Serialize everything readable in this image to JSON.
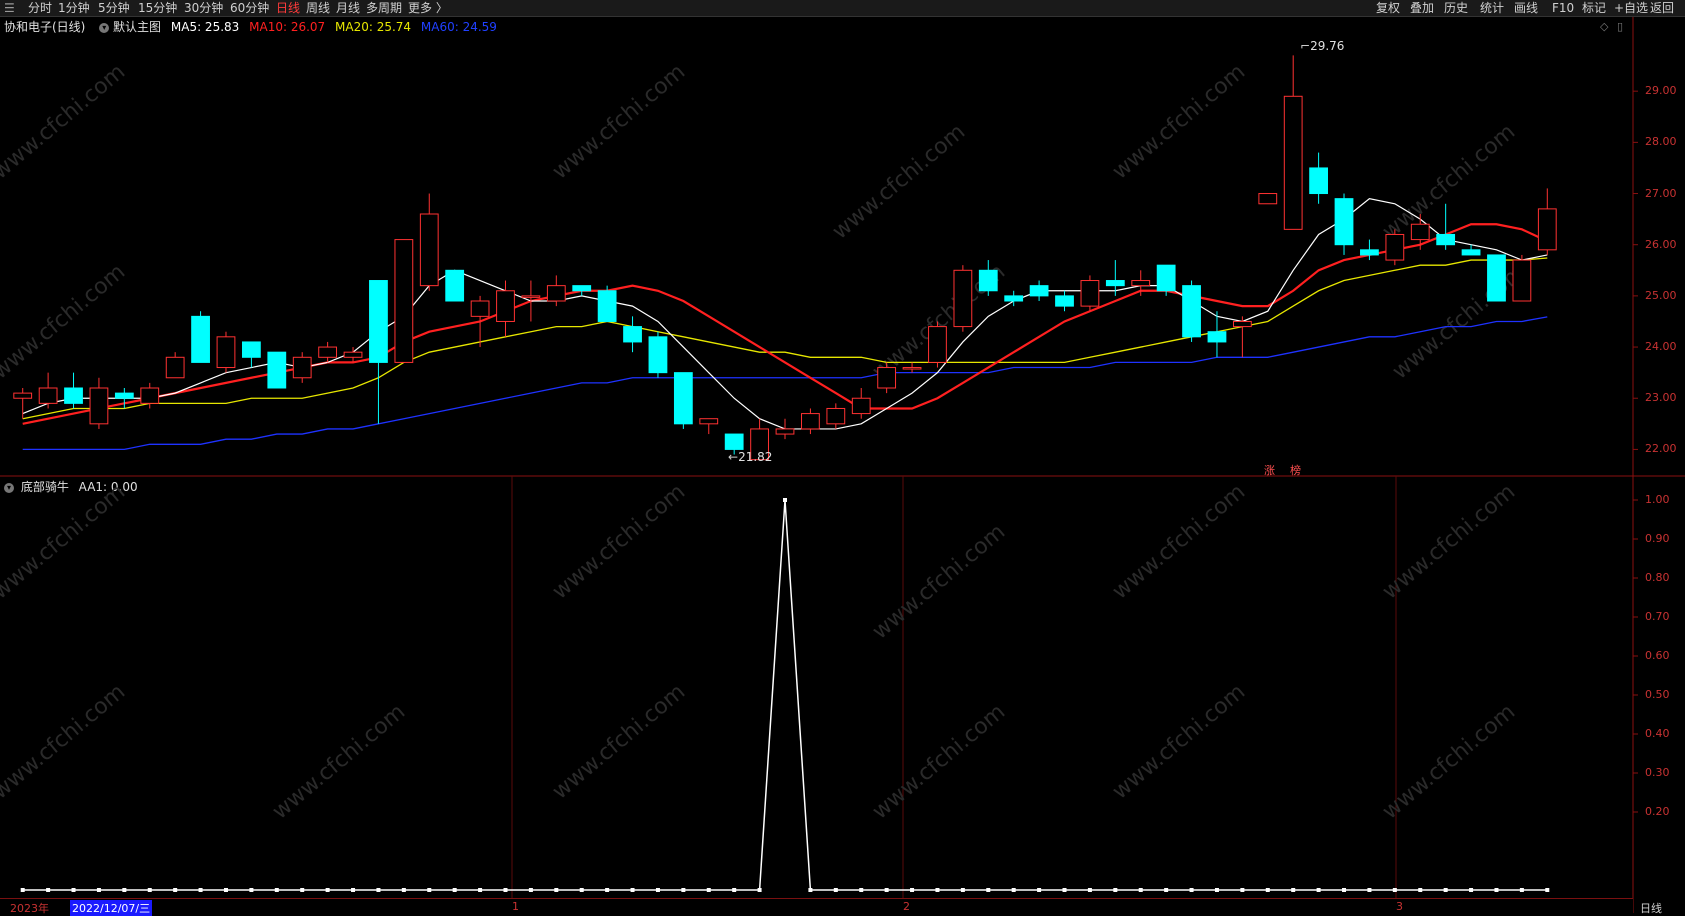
{
  "toolbar": {
    "menu_icon": "menu-icon",
    "periods": [
      "分时",
      "1分钟",
      "5分钟",
      "15分钟",
      "30分钟",
      "60分钟",
      "日线",
      "周线",
      "月线",
      "多周期",
      "更多 〉"
    ],
    "active_period": "日线",
    "right_items": [
      "复权",
      "叠加",
      "历史",
      "统计",
      "画线",
      "F10",
      "标记",
      "+自选",
      "返回"
    ]
  },
  "main_chart": {
    "stock_title": "协和电子(日线)",
    "template": "默认主图",
    "ma5": "MA5: 25.83",
    "ma10": "MA10: 26.07",
    "ma20": "MA20: 25.74",
    "ma60": "MA60: 24.59",
    "high_annotation": "29.76",
    "low_annotation": "21.82",
    "badges": [
      "涨",
      "榜"
    ],
    "price_ticks": [
      "29.00",
      "28.00",
      "27.00",
      "26.00",
      "25.00",
      "24.00",
      "23.00",
      "22.00"
    ],
    "colors": {
      "up": "#ff3232",
      "down": "#00ffff",
      "ma5": "#ffffff",
      "ma10": "#ff2020",
      "ma20": "#e6e600",
      "ma60": "#1e32ff"
    }
  },
  "sub_chart": {
    "indicator_name": "底部骑牛",
    "aa1": "AA1: 0.00",
    "ticks": [
      "1.00",
      "0.90",
      "0.80",
      "0.70",
      "0.60",
      "0.50",
      "0.40",
      "0.30",
      "0.20"
    ]
  },
  "date_axis": {
    "year_label": "2023年",
    "cursor_date": "2022/12/07/三",
    "month_labels": [
      "1",
      "2",
      "3"
    ],
    "period_label": "日线"
  },
  "watermark": "www.cfchi.com",
  "chart_data": {
    "type": "candlestick",
    "candles": [
      {
        "o": 23.0,
        "c": 23.1,
        "h": 23.2,
        "l": 22.6
      },
      {
        "o": 22.9,
        "c": 23.2,
        "h": 23.5,
        "l": 22.8
      },
      {
        "o": 23.2,
        "c": 22.9,
        "h": 23.5,
        "l": 22.8
      },
      {
        "o": 22.5,
        "c": 23.2,
        "h": 23.4,
        "l": 22.4
      },
      {
        "o": 23.1,
        "c": 23.0,
        "h": 23.2,
        "l": 22.8
      },
      {
        "o": 22.9,
        "c": 23.2,
        "h": 23.3,
        "l": 22.8
      },
      {
        "o": 23.4,
        "c": 23.8,
        "h": 23.9,
        "l": 23.4
      },
      {
        "o": 24.6,
        "c": 23.7,
        "h": 24.7,
        "l": 23.7
      },
      {
        "o": 23.6,
        "c": 24.2,
        "h": 24.3,
        "l": 23.5
      },
      {
        "o": 24.1,
        "c": 23.8,
        "h": 24.1,
        "l": 23.6
      },
      {
        "o": 23.9,
        "c": 23.2,
        "h": 23.9,
        "l": 23.2
      },
      {
        "o": 23.4,
        "c": 23.8,
        "h": 23.9,
        "l": 23.3
      },
      {
        "o": 23.8,
        "c": 24.0,
        "h": 24.1,
        "l": 23.7
      },
      {
        "o": 23.8,
        "c": 23.9,
        "h": 24.0,
        "l": 23.7
      },
      {
        "o": 25.3,
        "c": 23.7,
        "h": 25.3,
        "l": 22.5
      },
      {
        "o": 23.7,
        "c": 26.1,
        "h": 26.1,
        "l": 23.7
      },
      {
        "o": 25.2,
        "c": 26.6,
        "h": 27.0,
        "l": 25.1
      },
      {
        "o": 25.5,
        "c": 24.9,
        "h": 25.5,
        "l": 24.9
      },
      {
        "o": 24.6,
        "c": 24.9,
        "h": 25.0,
        "l": 24.0
      },
      {
        "o": 24.5,
        "c": 25.1,
        "h": 25.3,
        "l": 24.2
      },
      {
        "o": 25.0,
        "c": 25.0,
        "h": 25.3,
        "l": 24.5
      },
      {
        "o": 24.9,
        "c": 25.2,
        "h": 25.4,
        "l": 24.8
      },
      {
        "o": 25.2,
        "c": 25.1,
        "h": 25.2,
        "l": 25.0
      },
      {
        "o": 25.1,
        "c": 24.5,
        "h": 25.2,
        "l": 24.5
      },
      {
        "o": 24.4,
        "c": 24.1,
        "h": 24.6,
        "l": 23.9
      },
      {
        "o": 24.2,
        "c": 23.5,
        "h": 24.3,
        "l": 23.4
      },
      {
        "o": 23.5,
        "c": 22.5,
        "h": 23.5,
        "l": 22.4
      },
      {
        "o": 22.5,
        "c": 22.6,
        "h": 22.6,
        "l": 22.3
      },
      {
        "o": 22.3,
        "c": 22.0,
        "h": 22.3,
        "l": 21.9
      },
      {
        "o": 21.8,
        "c": 22.4,
        "h": 22.6,
        "l": 21.8
      },
      {
        "o": 22.3,
        "c": 22.4,
        "h": 22.6,
        "l": 22.2
      },
      {
        "o": 22.4,
        "c": 22.7,
        "h": 22.8,
        "l": 22.3
      },
      {
        "o": 22.5,
        "c": 22.8,
        "h": 22.9,
        "l": 22.4
      },
      {
        "o": 22.7,
        "c": 23.0,
        "h": 23.2,
        "l": 22.6
      },
      {
        "o": 23.2,
        "c": 23.6,
        "h": 23.7,
        "l": 23.1
      },
      {
        "o": 23.6,
        "c": 23.6,
        "h": 23.7,
        "l": 23.5
      },
      {
        "o": 23.7,
        "c": 24.4,
        "h": 24.5,
        "l": 23.6
      },
      {
        "o": 24.4,
        "c": 25.5,
        "h": 25.6,
        "l": 24.3
      },
      {
        "o": 25.5,
        "c": 25.1,
        "h": 25.7,
        "l": 25.0
      },
      {
        "o": 25.0,
        "c": 24.9,
        "h": 25.1,
        "l": 24.8
      },
      {
        "o": 25.2,
        "c": 25.0,
        "h": 25.3,
        "l": 24.9
      },
      {
        "o": 25.0,
        "c": 24.8,
        "h": 25.1,
        "l": 24.7
      },
      {
        "o": 24.8,
        "c": 25.3,
        "h": 25.4,
        "l": 24.7
      },
      {
        "o": 25.3,
        "c": 25.2,
        "h": 25.7,
        "l": 25.0
      },
      {
        "o": 25.2,
        "c": 25.3,
        "h": 25.5,
        "l": 25.0
      },
      {
        "o": 25.6,
        "c": 25.1,
        "h": 25.6,
        "l": 25.0
      },
      {
        "o": 25.2,
        "c": 24.2,
        "h": 25.3,
        "l": 24.1
      },
      {
        "o": 24.3,
        "c": 24.1,
        "h": 24.7,
        "l": 23.8
      },
      {
        "o": 24.4,
        "c": 24.5,
        "h": 24.6,
        "l": 23.8
      },
      {
        "o": 26.8,
        "c": 27.0,
        "h": 27.0,
        "l": 26.8
      },
      {
        "o": 26.3,
        "c": 28.9,
        "h": 29.7,
        "l": 26.3
      },
      {
        "o": 27.5,
        "c": 27.0,
        "h": 27.8,
        "l": 26.8
      },
      {
        "o": 26.9,
        "c": 26.0,
        "h": 27.0,
        "l": 25.8
      },
      {
        "o": 25.9,
        "c": 25.8,
        "h": 26.1,
        "l": 25.7
      },
      {
        "o": 25.7,
        "c": 26.2,
        "h": 26.3,
        "l": 25.6
      },
      {
        "o": 26.1,
        "c": 26.4,
        "h": 26.6,
        "l": 25.9
      },
      {
        "o": 26.2,
        "c": 26.0,
        "h": 26.8,
        "l": 25.9
      },
      {
        "o": 25.9,
        "c": 25.8,
        "h": 26.0,
        "l": 25.8
      },
      {
        "o": 25.8,
        "c": 24.9,
        "h": 25.8,
        "l": 24.9
      },
      {
        "o": 24.9,
        "c": 25.7,
        "h": 25.8,
        "l": 24.9
      },
      {
        "o": 25.9,
        "c": 26.7,
        "h": 27.1,
        "l": 25.8
      }
    ],
    "ma5": [
      22.7,
      22.9,
      23.0,
      23.0,
      23.0,
      23.0,
      23.1,
      23.3,
      23.5,
      23.6,
      23.7,
      23.6,
      23.7,
      23.9,
      24.3,
      24.6,
      25.2,
      25.5,
      25.3,
      25.1,
      24.9,
      24.9,
      25.0,
      24.9,
      24.8,
      24.5,
      24.0,
      23.5,
      23.0,
      22.6,
      22.4,
      22.4,
      22.4,
      22.5,
      22.8,
      23.1,
      23.5,
      24.1,
      24.6,
      24.9,
      25.1,
      25.1,
      25.1,
      25.1,
      25.2,
      25.2,
      24.9,
      24.6,
      24.5,
      24.7,
      25.5,
      26.2,
      26.5,
      26.9,
      26.8,
      26.5,
      26.1,
      26.0,
      25.9,
      25.7,
      25.8
    ],
    "ma10": [
      22.5,
      22.6,
      22.7,
      22.8,
      22.9,
      23.0,
      23.1,
      23.2,
      23.3,
      23.4,
      23.5,
      23.6,
      23.7,
      23.7,
      23.8,
      24.1,
      24.3,
      24.4,
      24.5,
      24.7,
      24.9,
      25.0,
      25.1,
      25.1,
      25.2,
      25.1,
      24.9,
      24.6,
      24.3,
      24.0,
      23.7,
      23.4,
      23.1,
      22.8,
      22.8,
      22.8,
      23.0,
      23.3,
      23.6,
      23.9,
      24.2,
      24.5,
      24.7,
      24.9,
      25.1,
      25.1,
      25.0,
      24.9,
      24.8,
      24.8,
      25.1,
      25.5,
      25.7,
      25.8,
      25.9,
      26.0,
      26.2,
      26.4,
      26.4,
      26.3,
      26.07
    ],
    "ma20": [
      22.6,
      22.7,
      22.8,
      22.8,
      22.8,
      22.9,
      22.9,
      22.9,
      22.9,
      23.0,
      23.0,
      23.0,
      23.1,
      23.2,
      23.4,
      23.7,
      23.9,
      24.0,
      24.1,
      24.2,
      24.3,
      24.4,
      24.4,
      24.5,
      24.4,
      24.3,
      24.2,
      24.1,
      24.0,
      23.9,
      23.9,
      23.8,
      23.8,
      23.8,
      23.7,
      23.7,
      23.7,
      23.7,
      23.7,
      23.7,
      23.7,
      23.7,
      23.8,
      23.9,
      24.0,
      24.1,
      24.2,
      24.3,
      24.4,
      24.5,
      24.8,
      25.1,
      25.3,
      25.4,
      25.5,
      25.6,
      25.6,
      25.7,
      25.7,
      25.7,
      25.74
    ],
    "ma60": [
      22.0,
      22.0,
      22.0,
      22.0,
      22.0,
      22.1,
      22.1,
      22.1,
      22.2,
      22.2,
      22.3,
      22.3,
      22.4,
      22.4,
      22.5,
      22.6,
      22.7,
      22.8,
      22.9,
      23.0,
      23.1,
      23.2,
      23.3,
      23.3,
      23.4,
      23.4,
      23.4,
      23.4,
      23.4,
      23.4,
      23.4,
      23.4,
      23.4,
      23.4,
      23.5,
      23.5,
      23.5,
      23.5,
      23.5,
      23.6,
      23.6,
      23.6,
      23.6,
      23.7,
      23.7,
      23.7,
      23.7,
      23.8,
      23.8,
      23.8,
      23.9,
      24.0,
      24.1,
      24.2,
      24.2,
      24.3,
      24.4,
      24.4,
      24.5,
      24.5,
      24.59
    ],
    "indicator": [
      0,
      0,
      0,
      0,
      0,
      0,
      0,
      0,
      0,
      0,
      0,
      0,
      0,
      0,
      0,
      0,
      0,
      0,
      0,
      0,
      0,
      0,
      0,
      0,
      0,
      0,
      0,
      0,
      0,
      0,
      1,
      0,
      0,
      0,
      0,
      0,
      0,
      0,
      0,
      0,
      0,
      0,
      0,
      0,
      0,
      0,
      0,
      0,
      0,
      0,
      0,
      0,
      0,
      0,
      0,
      0,
      0,
      0,
      0,
      0,
      0
    ],
    "ylim_price": [
      21.5,
      30.0
    ],
    "ylim_indicator": [
      0,
      1.0
    ]
  }
}
